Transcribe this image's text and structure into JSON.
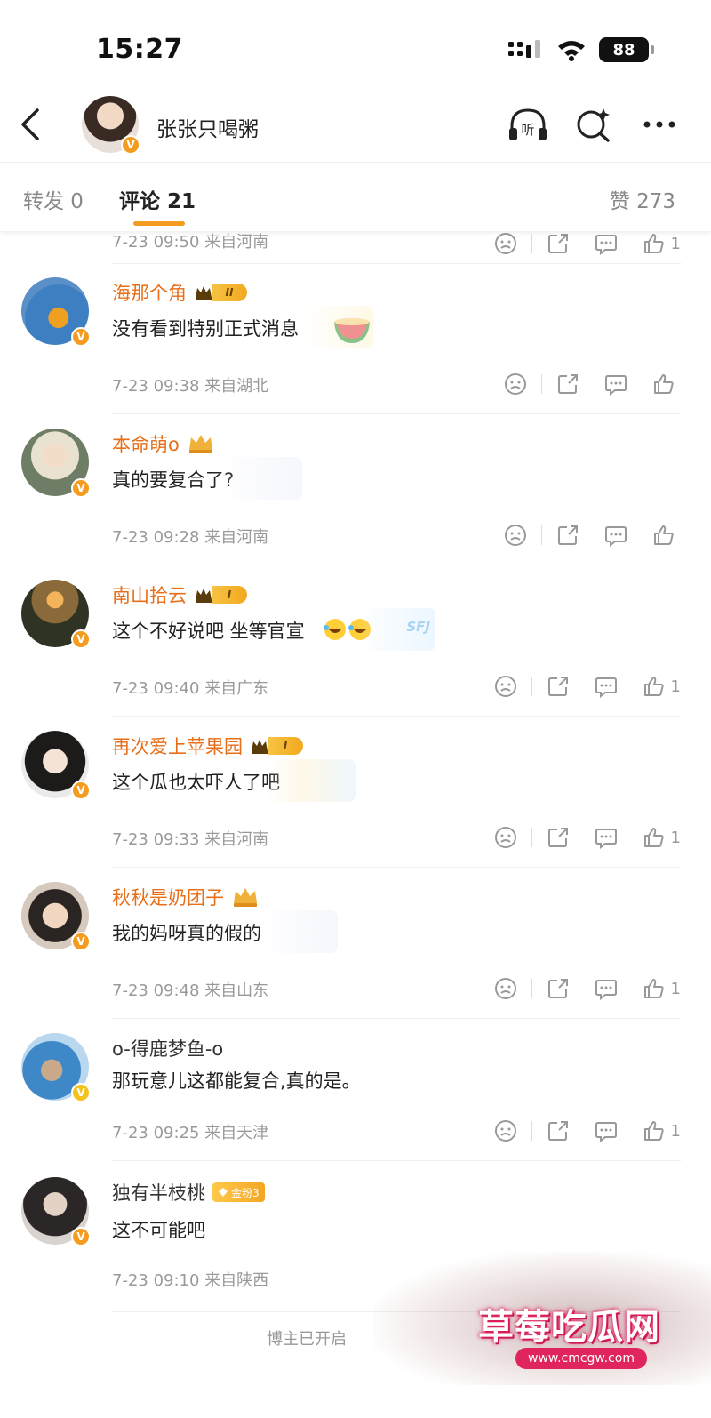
{
  "status_bar": {
    "time": "15:27",
    "battery": "88"
  },
  "header": {
    "name": "张张只喝粥",
    "listen_label": "听"
  },
  "tabs": {
    "repost": "转发 0",
    "comment": "评论 21",
    "like": "赞 273"
  },
  "first_meta": {
    "date": "7-23 09:50 来自河南",
    "like_count": "1"
  },
  "comments": [
    {
      "name": "海那个角",
      "level": "II",
      "text": "没有看到特别正式消息",
      "date": "7-23 09:38 来自湖北",
      "like_count": ""
    },
    {
      "name": "本命萌o",
      "level": "",
      "text": "真的要复合了?",
      "date": "7-23 09:28 来自河南",
      "like_count": ""
    },
    {
      "name": "南山拾云",
      "level": "I",
      "text": "这个不好说吧 坐等官宣",
      "date": "7-23 09:40 来自广东",
      "like_count": "1"
    },
    {
      "name": "再次爱上苹果园",
      "level": "I",
      "text": "这个瓜也太吓人了吧",
      "date": "7-23 09:33 来自河南",
      "like_count": "1"
    },
    {
      "name": "秋秋是奶团子",
      "level": "",
      "text": "我的妈呀真的假的",
      "date": "7-23 09:48 来自山东",
      "like_count": "1"
    },
    {
      "name": "o-得鹿梦鱼-o",
      "level": "",
      "text": "那玩意儿这都能复合,真的是。",
      "date": "7-23 09:25 来自天津",
      "like_count": "1"
    },
    {
      "name": "独有半枝桃",
      "fan_badge": "金粉3",
      "text": "这不可能吧",
      "date": "7-23 09:10 来自陕西",
      "like_count": ""
    }
  ],
  "footer_note": "博主已开启",
  "watermark": {
    "title": "草莓吃瓜网",
    "url": "www.cmcgw.com"
  },
  "colors": {
    "accent": "#f39c1f",
    "username": "#e86f1a",
    "meta": "#999999"
  }
}
